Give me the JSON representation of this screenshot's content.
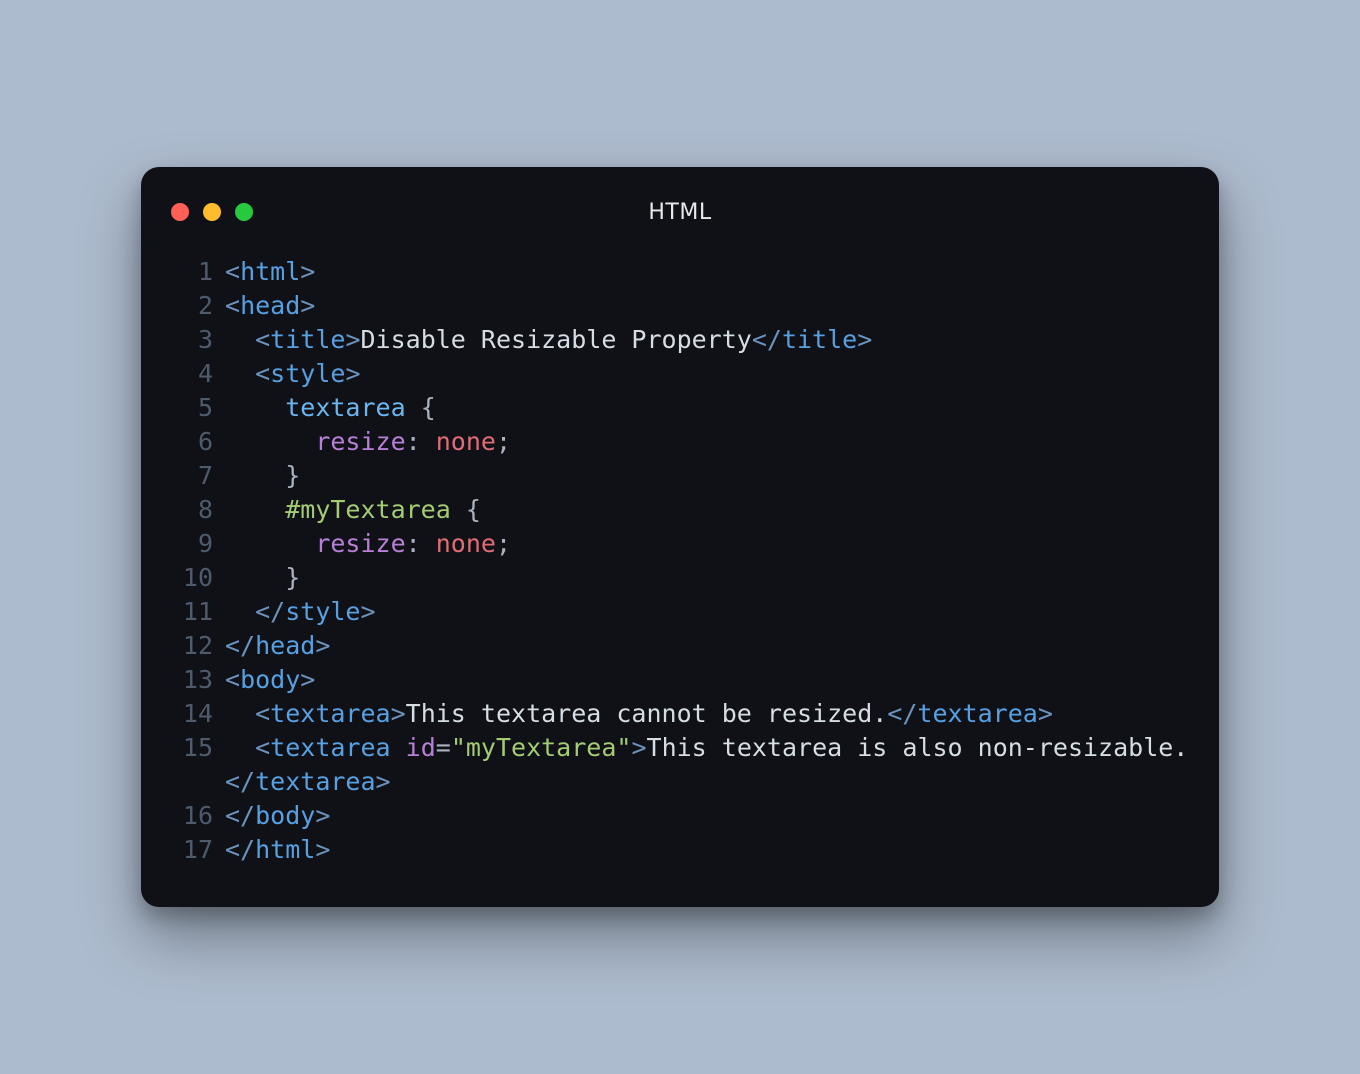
{
  "window": {
    "title": "HTML",
    "traffic": {
      "red": "#ff5f56",
      "yellow": "#ffbd2e",
      "green": "#27c93f"
    }
  },
  "code": {
    "language": "html",
    "line_numbers": [
      "1",
      "2",
      "3",
      "4",
      "5",
      "6",
      "7",
      "8",
      "9",
      "10",
      "11",
      "12",
      "13",
      "14",
      "15",
      "16",
      "17"
    ],
    "tokens": [
      [
        [
          "c-pun",
          "<"
        ],
        [
          "c-tag",
          "html"
        ],
        [
          "c-pun",
          ">"
        ]
      ],
      [
        [
          "c-pun",
          "<"
        ],
        [
          "c-tag",
          "head"
        ],
        [
          "c-pun",
          ">"
        ]
      ],
      [
        [
          "c-plain",
          "  "
        ],
        [
          "c-pun",
          "<"
        ],
        [
          "c-tag",
          "title"
        ],
        [
          "c-pun",
          ">"
        ],
        [
          "c-plain",
          "Disable Resizable Property"
        ],
        [
          "c-pun",
          "</"
        ],
        [
          "c-tag",
          "title"
        ],
        [
          "c-pun",
          ">"
        ]
      ],
      [
        [
          "c-plain",
          "  "
        ],
        [
          "c-pun",
          "<"
        ],
        [
          "c-tag",
          "style"
        ],
        [
          "c-pun",
          ">"
        ]
      ],
      [
        [
          "c-plain",
          "    "
        ],
        [
          "c-sel",
          "textarea"
        ],
        [
          "c-plain",
          " "
        ],
        [
          "c-punp",
          "{"
        ]
      ],
      [
        [
          "c-plain",
          "      "
        ],
        [
          "c-prop",
          "resize"
        ],
        [
          "c-punp",
          ":"
        ],
        [
          "c-plain",
          " "
        ],
        [
          "c-val",
          "none"
        ],
        [
          "c-punp",
          ";"
        ]
      ],
      [
        [
          "c-plain",
          "    "
        ],
        [
          "c-punp",
          "}"
        ]
      ],
      [
        [
          "c-plain",
          "    "
        ],
        [
          "c-selid",
          "#myTextarea"
        ],
        [
          "c-plain",
          " "
        ],
        [
          "c-punp",
          "{"
        ]
      ],
      [
        [
          "c-plain",
          "      "
        ],
        [
          "c-prop",
          "resize"
        ],
        [
          "c-punp",
          ":"
        ],
        [
          "c-plain",
          " "
        ],
        [
          "c-val",
          "none"
        ],
        [
          "c-punp",
          ";"
        ]
      ],
      [
        [
          "c-plain",
          "    "
        ],
        [
          "c-punp",
          "}"
        ]
      ],
      [
        [
          "c-plain",
          "  "
        ],
        [
          "c-pun",
          "</"
        ],
        [
          "c-tag",
          "style"
        ],
        [
          "c-pun",
          ">"
        ]
      ],
      [
        [
          "c-pun",
          "</"
        ],
        [
          "c-tag",
          "head"
        ],
        [
          "c-pun",
          ">"
        ]
      ],
      [
        [
          "c-pun",
          "<"
        ],
        [
          "c-tag",
          "body"
        ],
        [
          "c-pun",
          ">"
        ]
      ],
      [
        [
          "c-plain",
          "  "
        ],
        [
          "c-pun",
          "<"
        ],
        [
          "c-tag",
          "textarea"
        ],
        [
          "c-pun",
          ">"
        ],
        [
          "c-plain",
          "This textarea cannot be resized."
        ],
        [
          "c-pun",
          "</"
        ],
        [
          "c-tag",
          "textarea"
        ],
        [
          "c-pun",
          ">"
        ]
      ],
      [
        [
          "c-plain",
          "  "
        ],
        [
          "c-pun",
          "<"
        ],
        [
          "c-tag",
          "textarea"
        ],
        [
          "c-plain",
          " "
        ],
        [
          "c-attr",
          "id"
        ],
        [
          "c-punp",
          "="
        ],
        [
          "c-str",
          "\"myTextarea\""
        ],
        [
          "c-pun",
          ">"
        ],
        [
          "c-plain",
          "This textarea is also non-resizable."
        ],
        [
          "c-pun",
          "</"
        ],
        [
          "c-tag",
          "textarea"
        ],
        [
          "c-pun",
          ">"
        ]
      ],
      [
        [
          "c-pun",
          "</"
        ],
        [
          "c-tag",
          "body"
        ],
        [
          "c-pun",
          ">"
        ]
      ],
      [
        [
          "c-pun",
          "</"
        ],
        [
          "c-tag",
          "html"
        ],
        [
          "c-pun",
          ">"
        ]
      ]
    ]
  }
}
